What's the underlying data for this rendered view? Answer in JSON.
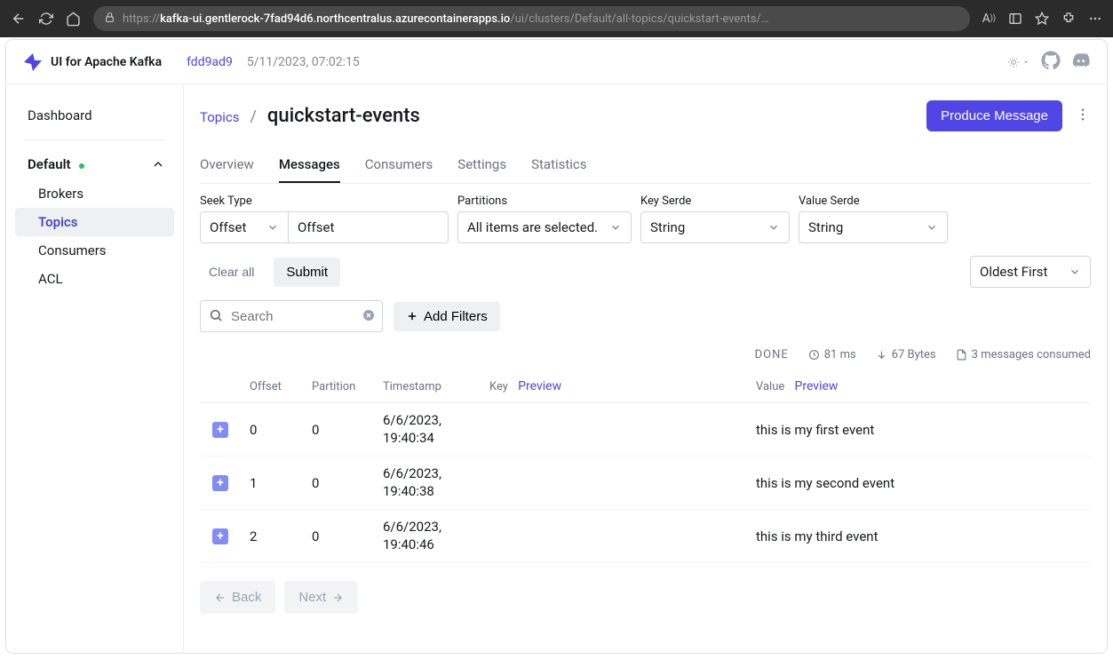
{
  "browser": {
    "url_host": "kafka-ui.gentlerock-7fad94d6.northcentralus.azurecontainerapps.io",
    "url_path": "/ui/clusters/Default/all-topics/quickstart-events/…"
  },
  "header": {
    "product": "UI for Apache Kafka",
    "version": "fdd9ad9",
    "build_ts": "5/11/2023, 07:02:15"
  },
  "sidebar": {
    "dashboard": "Dashboard",
    "cluster": "Default",
    "items": [
      "Brokers",
      "Topics",
      "Consumers",
      "ACL"
    ],
    "active_index": 1
  },
  "breadcrumb": {
    "parent": "Topics",
    "title": "quickstart-events"
  },
  "actions": {
    "produce": "Produce Message"
  },
  "tabs": [
    "Overview",
    "Messages",
    "Consumers",
    "Settings",
    "Statistics"
  ],
  "tabs_active_index": 1,
  "filters": {
    "seek_type_label": "Seek Type",
    "seek_type_value": "Offset",
    "seek_input_value": "Offset",
    "partitions_label": "Partitions",
    "partitions_value": "All items are selected.",
    "key_serde_label": "Key Serde",
    "key_serde_value": "String",
    "value_serde_label": "Value Serde",
    "value_serde_value": "String",
    "clear_all": "Clear all",
    "submit": "Submit",
    "sort_value": "Oldest First",
    "search_placeholder": "Search",
    "add_filters": "Add Filters"
  },
  "stats": {
    "status": "DONE",
    "time": "81 ms",
    "bytes": "67 Bytes",
    "consumed": "3 messages consumed"
  },
  "table": {
    "headers": {
      "offset": "Offset",
      "partition": "Partition",
      "timestamp": "Timestamp",
      "key": "Key",
      "value": "Value",
      "preview": "Preview"
    },
    "rows": [
      {
        "offset": "0",
        "partition": "0",
        "ts": "6/6/2023, 19:40:34",
        "key": "",
        "value": "this is my first event"
      },
      {
        "offset": "1",
        "partition": "0",
        "ts": "6/6/2023, 19:40:38",
        "key": "",
        "value": "this is my second event"
      },
      {
        "offset": "2",
        "partition": "0",
        "ts": "6/6/2023, 19:40:46",
        "key": "",
        "value": "this is my third event"
      }
    ]
  },
  "pager": {
    "back": "Back",
    "next": "Next"
  }
}
